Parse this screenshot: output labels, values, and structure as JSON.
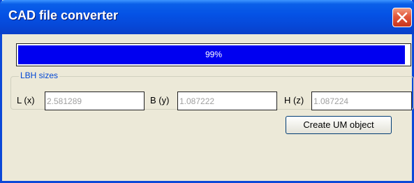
{
  "window": {
    "title": "CAD file converter"
  },
  "progress": {
    "label": "99%",
    "value_percent": 99
  },
  "lbh_group": {
    "title": "LBH sizes",
    "fields": [
      {
        "label": "L (x)",
        "value": "2.581289"
      },
      {
        "label": "B (y)",
        "value": "1.087222"
      },
      {
        "label": "H (z)",
        "value": "1.087224"
      }
    ]
  },
  "actions": {
    "create_label": "Create UM object"
  },
  "colors": {
    "progress_fill": "#0000f0",
    "titlebar": "#0553e6",
    "close_button": "#e2563a",
    "group_title": "#0046d5"
  },
  "icons": {
    "close": "close-icon"
  }
}
